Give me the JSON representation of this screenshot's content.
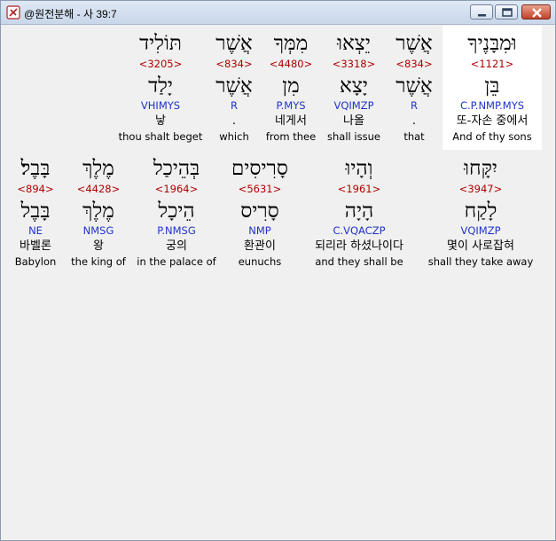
{
  "window": {
    "title": "@원전분해 - 사 39:7",
    "icon": "bible-app-icon"
  },
  "rows": [
    [
      {
        "hebrew": "וּמִבָּנֶיךָ",
        "strong": "<1121>",
        "root": "בֵּן",
        "morph": "C.P.NMP.MYS",
        "korean": "또-자손 중에서",
        "english": "And of thy sons",
        "selected": true
      },
      {
        "hebrew": "אֲשֶׁר",
        "strong": "<834>",
        "root": "אֲשֶׁר",
        "morph": "R",
        "korean": ".",
        "english": "that"
      },
      {
        "hebrew": "יֵצְאוּ",
        "strong": "<3318>",
        "root": "יָצָא",
        "morph": "VQIMZP",
        "korean": "나올",
        "english": "shall issue"
      },
      {
        "hebrew": "מִמְּךָ",
        "strong": "<4480>",
        "root": "מִן",
        "morph": "P.MYS",
        "korean": "네게서",
        "english": "from thee"
      },
      {
        "hebrew": "אֲשֶׁר",
        "strong": "<834>",
        "root": "אֲשֶׁר",
        "morph": "R",
        "korean": ".",
        "english": "which"
      },
      {
        "hebrew": "תּוֹלִיד",
        "strong": "<3205>",
        "root": "יָלַד",
        "morph": "VHIMYS",
        "korean": "낳",
        "english": "thou shalt beget"
      }
    ],
    [
      {
        "hebrew": "יִקָּחוּ",
        "strong": "<3947>",
        "root": "לָקַח",
        "morph": "VQIMZP",
        "korean": "몇이 사로잡혀",
        "english": "shall they take away"
      },
      {
        "hebrew": "וְהָיוּ",
        "strong": "<1961>",
        "root": "הָיָה",
        "morph": "C.VQACZP",
        "korean": "되리라 하셨나이다",
        "english": "and they shall be"
      },
      {
        "hebrew": "סָרִיסִים",
        "strong": "<5631>",
        "root": "סָרִיס",
        "morph": "NMP",
        "korean": "환관이",
        "english": "eunuchs"
      },
      {
        "hebrew": "בְּהֵיכַל",
        "strong": "<1964>",
        "root": "הֵיכָל",
        "morph": "P.NMSG",
        "korean": "궁의",
        "english": "in the palace of"
      },
      {
        "hebrew": "מֶלֶךְ",
        "strong": "<4428>",
        "root": "מֶלֶךְ",
        "morph": "NMSG",
        "korean": "왕",
        "english": "the king of"
      },
      {
        "hebrew": "בָּבֶל׃",
        "strong": "<894>",
        "root": "בָּבֶל",
        "morph": "NE",
        "korean": "바벨론",
        "english": "Babylon"
      }
    ]
  ],
  "colors": {
    "strong": "#b00000",
    "morph": "#2033c9",
    "selected_bg": "#ffffff",
    "content_bg": "#f0f0f0"
  }
}
